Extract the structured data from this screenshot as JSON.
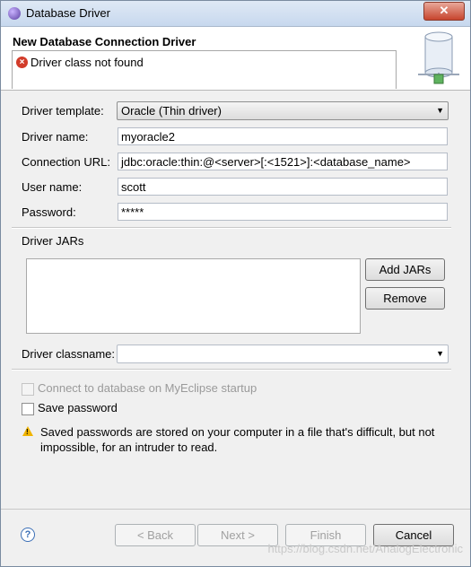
{
  "window": {
    "title": "Database Driver",
    "close_label": "✕"
  },
  "banner": {
    "title": "New Database Connection Driver",
    "error_message": "Driver class not found"
  },
  "form": {
    "driver_template": {
      "label": "Driver template:",
      "value": "Oracle (Thin driver)"
    },
    "driver_name": {
      "label": "Driver name:",
      "value": "myoracle2"
    },
    "connection_url": {
      "label": "Connection URL:",
      "value": "jdbc:oracle:thin:@<server>[:<1521>]:<database_name>"
    },
    "user_name": {
      "label": "User name:",
      "value": "scott"
    },
    "password": {
      "label": "Password:",
      "value": "*****"
    }
  },
  "jars": {
    "label": "Driver JARs",
    "add_label": "Add JARs",
    "remove_label": "Remove"
  },
  "classname": {
    "label": "Driver classname:",
    "value": ""
  },
  "options": {
    "connect_startup": {
      "label": "Connect to database on MyEclipse startup",
      "checked": false,
      "enabled": false
    },
    "save_password": {
      "label": "Save password",
      "checked": false,
      "enabled": true
    }
  },
  "warning": {
    "text": "Saved passwords are stored on your computer in a file that's difficult, but not impossible, for an intruder to read."
  },
  "buttons": {
    "back": "< Back",
    "next": "Next >",
    "finish": "Finish",
    "cancel": "Cancel"
  },
  "watermark": "https://blog.csdn.net/AnalogElectronic",
  "icons": {
    "help": "?",
    "error": "×",
    "warning": "!",
    "dropdown": "▼"
  }
}
